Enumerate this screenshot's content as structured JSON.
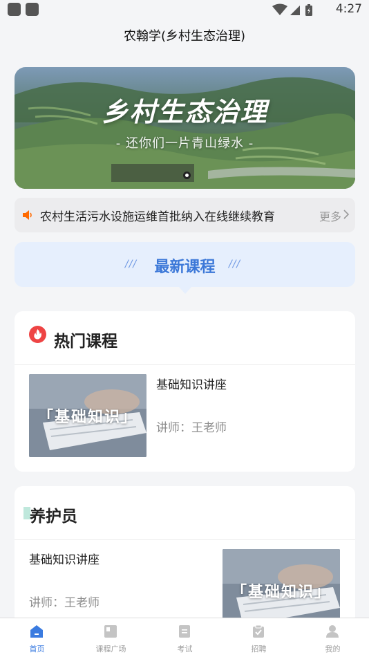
{
  "status_bar": {
    "time": "4:27"
  },
  "app_title": "农翰学(乡村生态治理)",
  "banner": {
    "title": "乡村生态治理",
    "subtitle": "- 还你们一片青山绿水 -"
  },
  "notice": {
    "text": "农村生活污水设施运维首批纳入在线继续教育",
    "more_label": "更多"
  },
  "latest": {
    "title": "最新课程",
    "deco_left": "///",
    "deco_right": "///"
  },
  "hot_section": {
    "title": "热门课程",
    "courses": [
      {
        "title": "基础知识讲座",
        "teacher": "讲师：王老师",
        "thumb_text": "「基础知识」"
      }
    ]
  },
  "keeper_section": {
    "title": "养护员",
    "courses": [
      {
        "title": "基础知识讲座",
        "teacher": "讲师：王老师",
        "thumb_text": "「基础知识」"
      }
    ]
  },
  "tabs": [
    {
      "label": "首页",
      "icon": "home-icon",
      "active": true
    },
    {
      "label": "课程广场",
      "icon": "course-square-icon",
      "active": false
    },
    {
      "label": "考试",
      "icon": "exam-icon",
      "active": false
    },
    {
      "label": "招聘",
      "icon": "recruit-icon",
      "active": false
    },
    {
      "label": "我的",
      "icon": "profile-icon",
      "active": false
    }
  ],
  "colors": {
    "accent": "#3a7be0",
    "hot": "#ee4444",
    "latest_bg": "#e6effd"
  }
}
